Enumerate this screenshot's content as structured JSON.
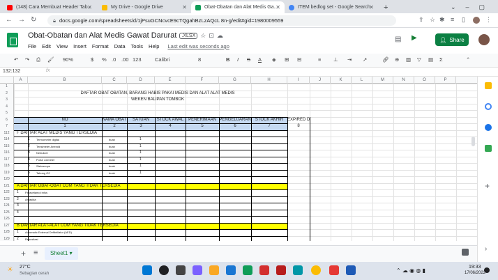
{
  "tabs": [
    {
      "title": "(148) Cara Membuat Header Tab...",
      "fav": "#ff0000"
    },
    {
      "title": "My Drive - Google Drive",
      "fav": "#fbbc04"
    },
    {
      "title": "Obat-Obatan dan Alat Medis Ga...",
      "fav": "#0f9d58"
    },
    {
      "title": "ITEM bedlog set - Google Search",
      "fav": "#4285f4"
    }
  ],
  "address": {
    "url": "docs.google.com/spreadsheets/d/1jPsuGCNcvcE9cTQgahBzLzAQcL 8n-g/edit#gid=1980009559"
  },
  "doc": {
    "title": "Obat-Obatan dan Alat Medis Gawat Darurat",
    "badge": ".XLSX",
    "share": "Share",
    "last_edit": "Last edit was seconds ago",
    "menus": [
      "File",
      "Edit",
      "View",
      "Insert",
      "Format",
      "Data",
      "Tools",
      "Help"
    ]
  },
  "toolbar": {
    "zoom": "90%",
    "currency": "$",
    "percent": "%",
    "dec1": ".0",
    "dec2": ".00",
    "numfmt": "123",
    "font": "Calibri",
    "size": "8"
  },
  "formula": {
    "cellref": "132:132",
    "fx": "fx"
  },
  "grid": {
    "columns": [
      "A",
      "B",
      "C",
      "D",
      "E",
      "F",
      "G",
      "H",
      "I",
      "J",
      "K",
      "L",
      "M",
      "N",
      "O",
      "P"
    ],
    "title1": "DAFTAR OBAT OBATAN, BARANG HABIS PAKAI MEDIS DAN ALAT ALAT MEDIS",
    "title2": "WEKEN BALIPAN TOMBOK",
    "headers": [
      "NO",
      "NAMA OBAT",
      "SATUAN",
      "STOCK AWAL",
      "PENERIMAAN",
      "PENGELUARAN",
      "STOCK AKHIR",
      "EXPIRED DATE"
    ],
    "hnums": [
      "1",
      "2",
      "3",
      "4",
      "5",
      "6",
      "7",
      "8"
    ],
    "section_f": "F  DAFTAR ALAT MEDIS YANG TERSEDIA",
    "items_f": [
      {
        "no": "1",
        "name": "Termometer digital",
        "unit": "buah",
        "qty": "1"
      },
      {
        "no": "2",
        "name": "Tensimeter Aneroid",
        "unit": "buah",
        "qty": "1"
      },
      {
        "no": "3",
        "name": "Nebulizer",
        "unit": "buah",
        "qty": "1"
      },
      {
        "no": "4",
        "name": "Pulse oximeter",
        "unit": "buah",
        "qty": "1"
      },
      {
        "no": "5",
        "name": "Stetoscope",
        "unit": "buah",
        "qty": "1"
      },
      {
        "no": "6",
        "name": "Tabung O2",
        "unit": "buah",
        "qty": "1"
      }
    ],
    "section_a": "A  DAFTAR OBAT-OBAT COM YANG TIDAK TERSEDIA",
    "items_a": [
      {
        "no": "1",
        "name": "Paracetamol infus"
      },
      {
        "no": "2",
        "name": "Antasida"
      },
      {
        "no": "3",
        "name": ""
      },
      {
        "no": "4",
        "name": ""
      }
    ],
    "section_b": "B  DAFTAR ALAT-ALAT COM YANG TIDAK TERSEDIA",
    "items_b": [
      {
        "no": "1",
        "name": "Automatic External Defibrillator (AED)"
      },
      {
        "no": "2",
        "name": "Resusitasi"
      }
    ],
    "rows": [
      "1",
      "2",
      "3",
      "4",
      "5",
      "6",
      "7",
      "112",
      "114",
      "115",
      "116",
      "117",
      "118",
      "119",
      "120",
      "121",
      "122",
      "123",
      "124",
      "125",
      "126",
      "127",
      "128",
      "129"
    ]
  },
  "sheet": {
    "tab": "Sheet1"
  },
  "taskbar": {
    "temp": "27°C",
    "weather": "Sebagian cerah",
    "time": "19:33",
    "date": "17/06/2022"
  }
}
